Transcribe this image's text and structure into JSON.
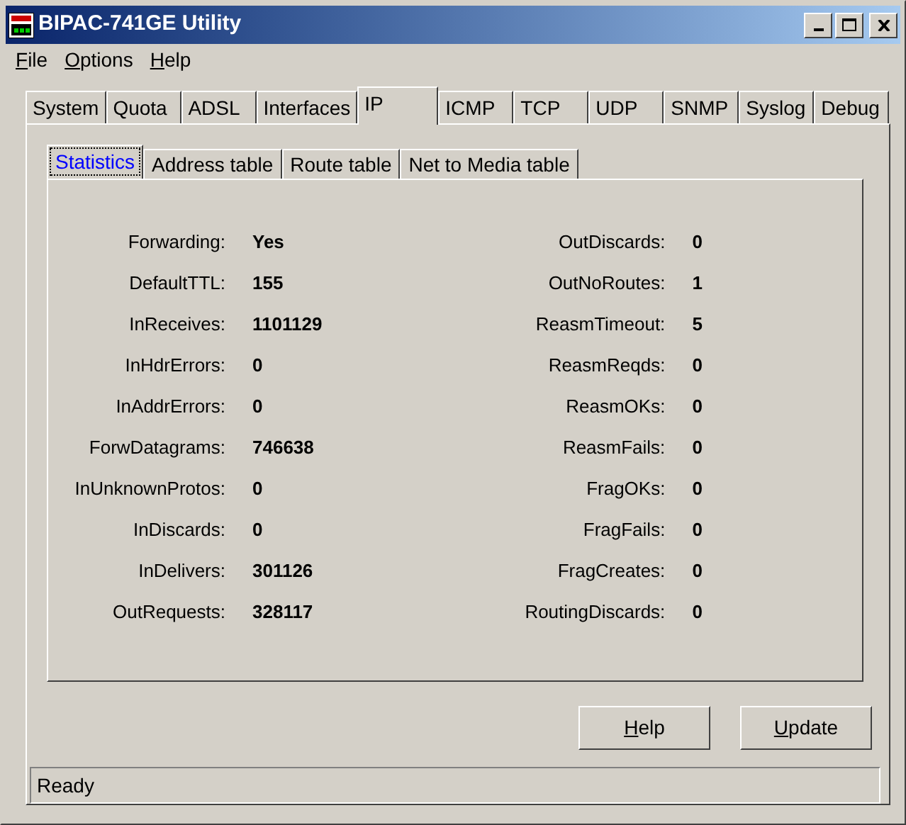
{
  "window": {
    "title": "BIPAC-741GE Utility"
  },
  "menu": [
    {
      "label": "File",
      "underline_first": true
    },
    {
      "label": "Options",
      "underline_first": true
    },
    {
      "label": "Help",
      "underline_first": true
    }
  ],
  "tabs": [
    {
      "label": "System",
      "selected": false
    },
    {
      "label": "Quota",
      "selected": false
    },
    {
      "label": "ADSL",
      "selected": false
    },
    {
      "label": "Interfaces",
      "selected": false
    },
    {
      "label": "IP",
      "selected": true
    },
    {
      "label": "ICMP",
      "selected": false
    },
    {
      "label": "TCP",
      "selected": false
    },
    {
      "label": "UDP",
      "selected": false
    },
    {
      "label": "SNMP",
      "selected": false
    },
    {
      "label": "Syslog",
      "selected": false
    },
    {
      "label": "Debug",
      "selected": false
    }
  ],
  "subtabs": [
    {
      "label": "Statistics",
      "selected": true
    },
    {
      "label": "Address table",
      "selected": false
    },
    {
      "label": "Route table",
      "selected": false
    },
    {
      "label": "Net to Media table",
      "selected": false
    }
  ],
  "stats_left": [
    {
      "label": "Forwarding:",
      "value": "Yes"
    },
    {
      "label": "DefaultTTL:",
      "value": "155"
    },
    {
      "label": "InReceives:",
      "value": "1101129"
    },
    {
      "label": "InHdrErrors:",
      "value": "0"
    },
    {
      "label": "InAddrErrors:",
      "value": "0"
    },
    {
      "label": "ForwDatagrams:",
      "value": "746638"
    },
    {
      "label": "InUnknownProtos:",
      "value": "0"
    },
    {
      "label": "InDiscards:",
      "value": "0"
    },
    {
      "label": "InDelivers:",
      "value": "301126"
    },
    {
      "label": "OutRequests:",
      "value": "328117"
    }
  ],
  "stats_right": [
    {
      "label": "OutDiscards:",
      "value": "0"
    },
    {
      "label": "OutNoRoutes:",
      "value": "1"
    },
    {
      "label": "ReasmTimeout:",
      "value": "5"
    },
    {
      "label": "ReasmReqds:",
      "value": "0"
    },
    {
      "label": "ReasmOKs:",
      "value": "0"
    },
    {
      "label": "ReasmFails:",
      "value": "0"
    },
    {
      "label": "FragOKs:",
      "value": "0"
    },
    {
      "label": "FragFails:",
      "value": "0"
    },
    {
      "label": "FragCreates:",
      "value": "0"
    },
    {
      "label": "RoutingDiscards:",
      "value": "0"
    }
  ],
  "buttons": [
    {
      "label": "Help",
      "underline_first": true
    },
    {
      "label": "Update",
      "underline_first": true
    }
  ],
  "status_bar": "Ready"
}
